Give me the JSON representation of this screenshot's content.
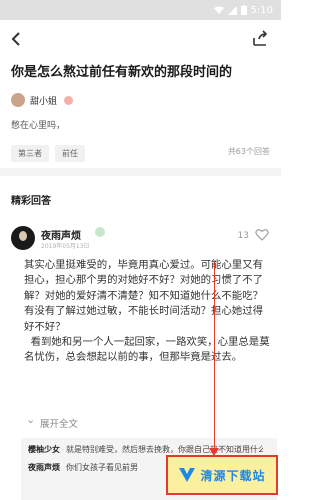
{
  "status_bar": {
    "time": "5:10"
  },
  "question": {
    "title": "你是怎么熬过前任有新欢的那段时间的",
    "author": "甜小姐",
    "description": "憋在心里吗，",
    "tags": [
      "第三者",
      "前任"
    ],
    "answers_count": "共63个回答"
  },
  "section": {
    "title": "精彩回答"
  },
  "answer": {
    "author": "夜雨声烦",
    "date": "2019年05月13日",
    "likes": "13",
    "body": "其实心里挺难受的，毕竟用真心爱过。可能心里又有担心，担心那个男的对她好不好？对她的习惯了不了解？对她的爱好清不清楚？知不知道她什么不能吃？有没有了解过她过敏，不能长时间活动？担心她过得好不好？\n  看到她和另一个人一起回家，一路欢笑，心里总是莫名忧伤，总会想起以前的事，但那毕竟是过去。",
    "expand_label": "展开全文"
  },
  "comments": [
    {
      "user": "樱柚少女",
      "text": "就是特别难受，然后想去挽救，你跟自己又不知道用什么身份"
    },
    {
      "user": "夜雨声烦",
      "text": "你们女孩子看见前男"
    }
  ],
  "watermark": {
    "text": "清源下载站"
  },
  "colors": {
    "annotation_red": "#e5392b",
    "watermark_yellow": "#ffec5a",
    "watermark_blue": "#1e88e5"
  }
}
